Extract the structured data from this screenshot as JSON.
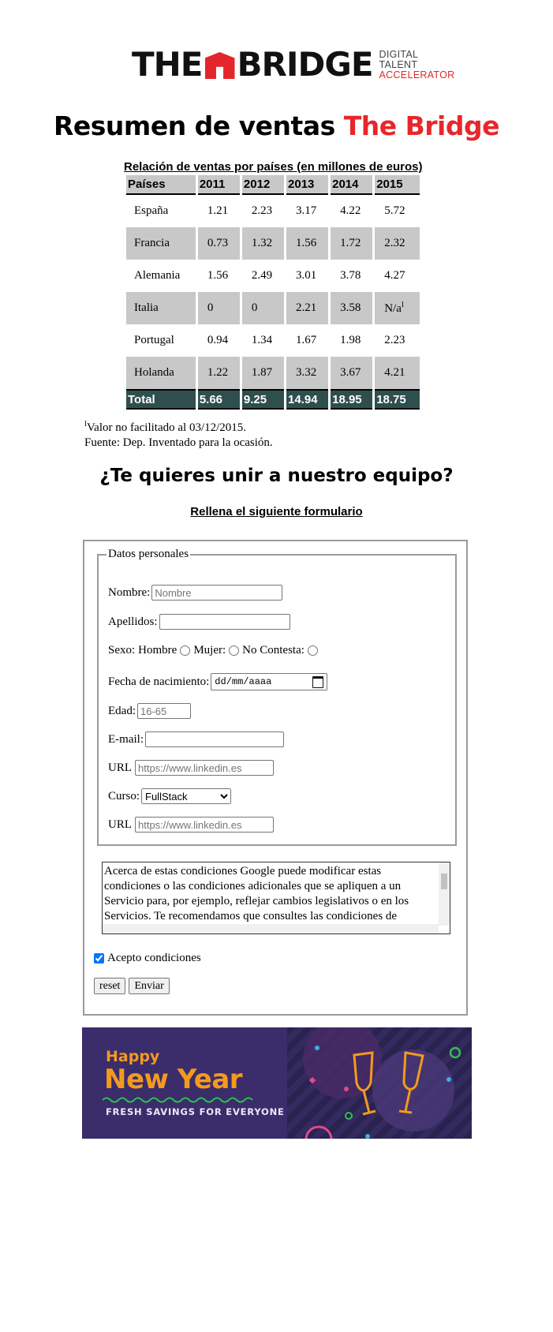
{
  "logo": {
    "main_left": "THE",
    "main_right": "BRIDGE",
    "tag_line1": "DIGITAL",
    "tag_line2": "TALENT",
    "tag_line3": "ACCELERATOR"
  },
  "title": {
    "text": "Resumen de ventas",
    "brand": "The Bridge"
  },
  "sales_table": {
    "caption": "Relación de ventas por países (en millones de euros)",
    "headers": [
      "Países",
      "2011",
      "2012",
      "2013",
      "2014",
      "2015"
    ],
    "rows": [
      [
        "España",
        "1.21",
        "2.23",
        "3.17",
        "4.22",
        "5.72"
      ],
      [
        "Francia",
        "0.73",
        "1.32",
        "1.56",
        "1.72",
        "2.32"
      ],
      [
        "Alemania",
        "1.56",
        "2.49",
        "3.01",
        "3.78",
        "4.27"
      ],
      [
        "Italia",
        "0",
        "0",
        "2.21",
        "3.58",
        "N/a"
      ],
      [
        "Portugal",
        "0.94",
        "1.34",
        "1.67",
        "1.98",
        "2.23"
      ],
      [
        "Holanda",
        "1.22",
        "1.87",
        "3.32",
        "3.67",
        "4.21"
      ]
    ],
    "total": [
      "Total",
      "5.66",
      "9.25",
      "14.94",
      "18.95",
      "18.75"
    ],
    "footnote_mark": "I"
  },
  "notes": {
    "footnote": "Valor no facilitado al 03/12/2015.",
    "source": "Fuente: Dep. Inventado para la ocasión."
  },
  "join_heading": "¿Te quieres unir a nuestro equipo?",
  "form_heading": "Rellena el siguiente formulario",
  "form": {
    "legend": "Datos personales",
    "nombre_label": "Nombre:",
    "nombre_placeholder": "Nombre",
    "apellidos_label": "Apellidos:",
    "sexo_label": "Sexo:",
    "sexo_hombre": "Hombre",
    "sexo_mujer": "Mujer:",
    "sexo_no_contesta": "No Contesta:",
    "fecha_label": "Fecha de nacimiento:",
    "fecha_value": "dd/mm/aaaa",
    "edad_label": "Edad:",
    "edad_placeholder": "16-65",
    "email_label": "E-mail:",
    "url_label": "URL",
    "url_placeholder": "https://www.linkedin.es",
    "curso_label": "Curso:",
    "curso_selected": "FullStack",
    "url2_label": "URL",
    "url2_placeholder": "https://www.linkedin.es",
    "conditions_text": "Acerca de estas condiciones Google puede modificar estas condiciones o las condiciones adicionales que se apliquen a un Servicio para, por ejemplo, reflejar cambios legislativos o en los Servicios. Te recomendamos que consultes las condiciones de",
    "accept_label": "Acepto condiciones",
    "reset_label": "reset",
    "submit_label": "Enviar"
  },
  "banner": {
    "happy": "Happy",
    "new_year": "New Year",
    "tagline": "FRESH SAVINGS FOR EVERYONE"
  },
  "colors": {
    "brand_red": "#e3262b",
    "table_gray": "#c8c8c8",
    "total_bg": "#2f4f4f",
    "banner_bg": "#3b2d6b",
    "banner_orange": "#f39a1e"
  }
}
